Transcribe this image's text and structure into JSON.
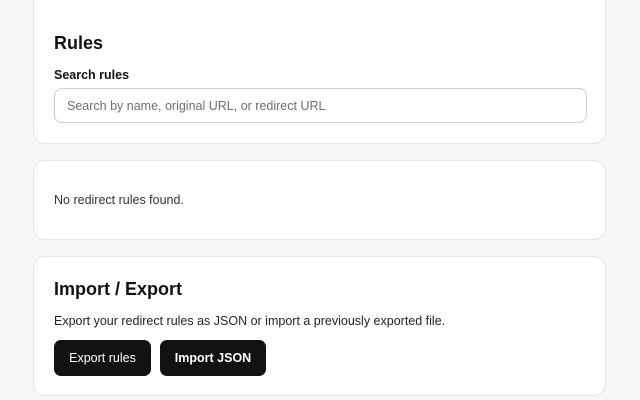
{
  "rules": {
    "title": "Rules",
    "search_label": "Search rules",
    "search_placeholder": "Search by name, original URL, or redirect URL",
    "search_value": ""
  },
  "rule_list": {
    "empty_message": "No redirect rules found."
  },
  "import_export": {
    "title": "Import / Export",
    "description": "Export your redirect rules as JSON or import a previously exported file.",
    "export_label": "Export rules",
    "import_label": "Import JSON"
  },
  "colors": {
    "page_background": "#f7f7f7",
    "card_background": "#ffffff",
    "card_border": "#e4e4e4",
    "button_background": "#121212",
    "button_text": "#ffffff"
  }
}
